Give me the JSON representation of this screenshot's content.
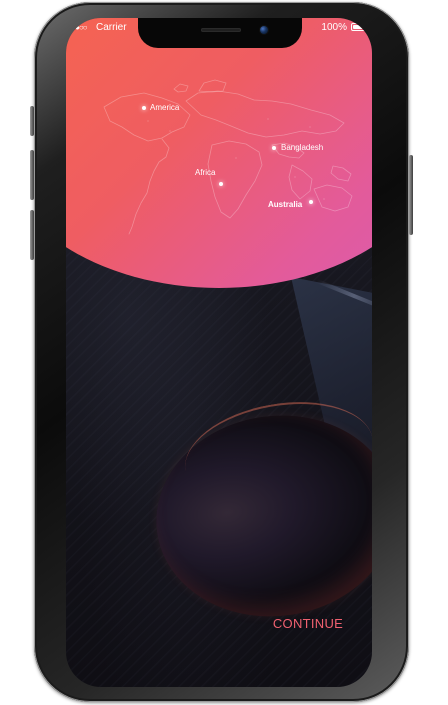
{
  "status_bar": {
    "signal_icon": "signal-dots-icon",
    "carrier": "Carrier",
    "battery": "100%",
    "battery_icon": "battery-icon"
  },
  "map": {
    "icon": "world-map-icon",
    "labels": {
      "america": "America",
      "bangladesh": "Bangladesh",
      "africa": "Africa",
      "australia": "Australia"
    }
  },
  "actions": {
    "continue": "CONTINUE"
  },
  "colors": {
    "gradient_start": "#f7664b",
    "gradient_mid": "#ef5d62",
    "gradient_end": "#d85cb4",
    "continue_text": "#f06170",
    "screen_dark": "#17171f"
  }
}
